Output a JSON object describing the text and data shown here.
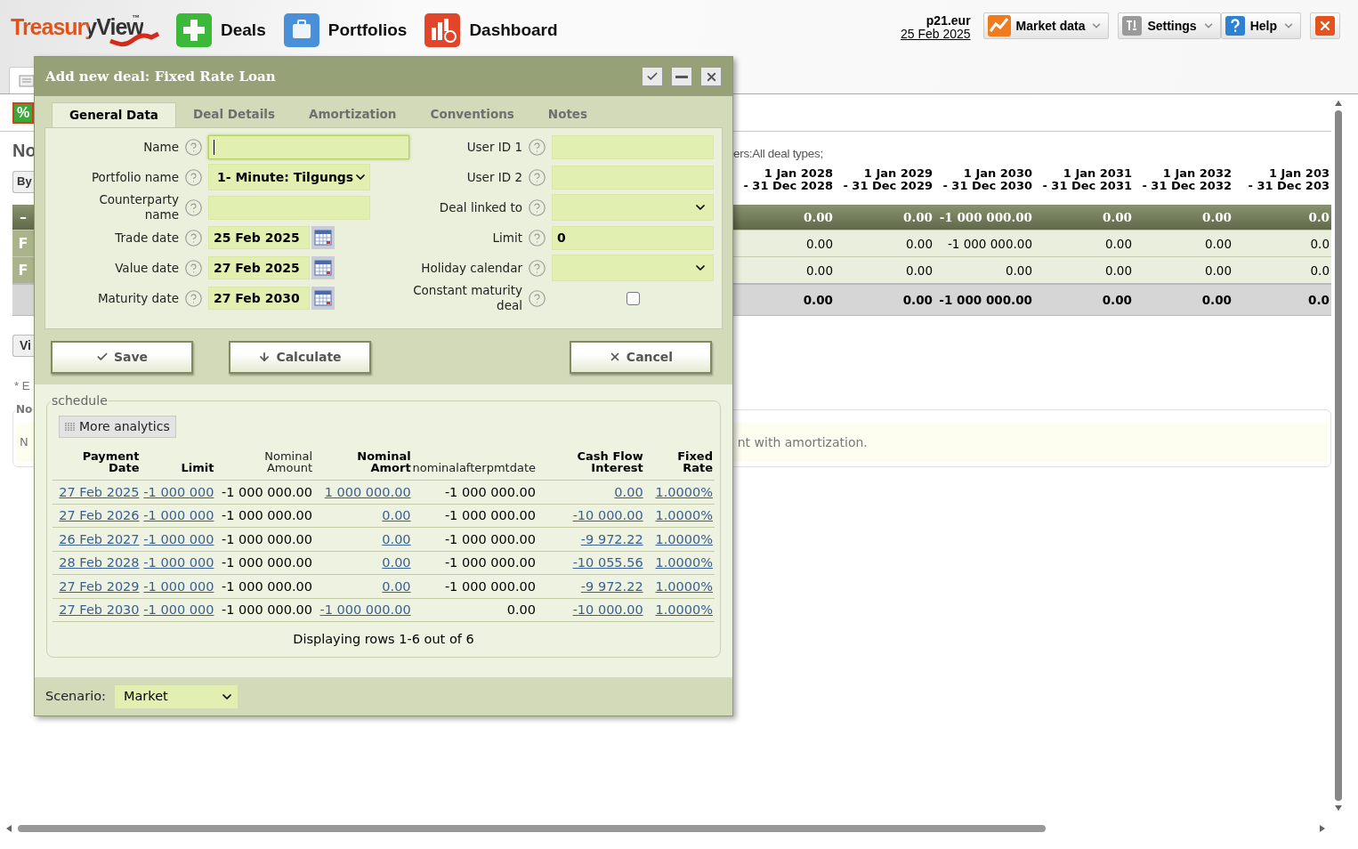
{
  "header": {
    "logo": "TreasuryView",
    "logo_mark": "™",
    "nav": [
      {
        "label": "Deals",
        "kind": "deals"
      },
      {
        "label": "Portfolios",
        "kind": "portfolios"
      },
      {
        "label": "Dashboard",
        "kind": "dashboard"
      }
    ],
    "user": "p21.eur",
    "date": "25 Feb 2025",
    "tools": [
      {
        "label": "Market data",
        "kind": "market"
      },
      {
        "label": "Settings",
        "kind": "settings"
      },
      {
        "label": "Help",
        "kind": "help"
      }
    ]
  },
  "background": {
    "percent_badge": "%",
    "heading": "No",
    "by_button": "By",
    "filter": "ers:All deal types;",
    "columns": [
      {
        "from": "1 Jan 2028",
        "to": "- 31 Dec 2028"
      },
      {
        "from": "1 Jan 2029",
        "to": "- 31 Dec 2029"
      },
      {
        "from": "1 Jan 2030",
        "to": "- 31 Dec 2030"
      },
      {
        "from": "1 Jan 2031",
        "to": "- 31 Dec 2031"
      },
      {
        "from": "1 Jan 2032",
        "to": "- 31 Dec 2032"
      },
      {
        "from": "1 Jan 203",
        "to": "- 31 Dec 203"
      }
    ],
    "group_row": {
      "mark": "–",
      "values": [
        "0.00",
        "0.00",
        "-1 000 000.00",
        "0.00",
        "0.00",
        "0.0"
      ]
    },
    "rows": [
      {
        "mark": "F",
        "values": [
          "0.00",
          "0.00",
          "-1 000 000.00",
          "0.00",
          "0.00",
          "0.0"
        ]
      },
      {
        "mark": "F",
        "values": [
          "0.00",
          "0.00",
          "0.00",
          "0.00",
          "0.00",
          "0.0"
        ]
      }
    ],
    "total_row": [
      "0.00",
      "0.00",
      "-1 000 000.00",
      "0.00",
      "0.00",
      "0.0"
    ],
    "view_button": "Vi",
    "footnote": "* E",
    "note_legend": "No",
    "note_start": "N",
    "note_end": "nt with amortization."
  },
  "dialog": {
    "title": "Add new deal: Fixed Rate Loan",
    "tabs": [
      {
        "label": "General Data",
        "selected": true
      },
      {
        "label": "Deal Details",
        "selected": false
      },
      {
        "label": "Amortization",
        "selected": false
      },
      {
        "label": "Conventions",
        "selected": false
      },
      {
        "label": "Notes",
        "selected": false
      }
    ],
    "left_fields": [
      {
        "label": "Name",
        "kind": "text",
        "focused": true
      },
      {
        "label": "Portfolio name",
        "kind": "select",
        "value": "1- Minute: Tilgungs",
        "focused": false
      },
      {
        "label": "Counterparty name",
        "kind": "text",
        "focused": false
      },
      {
        "label": "Trade date",
        "kind": "date",
        "value": "25 Feb 2025",
        "focused": false
      },
      {
        "label": "Value date",
        "kind": "date",
        "value": "27 Feb 2025",
        "focused": false
      },
      {
        "label": "Maturity date",
        "kind": "date",
        "value": "27 Feb 2030",
        "focused": false
      }
    ],
    "right_fields": [
      {
        "label": "User ID 1",
        "kind": "text",
        "focused": false
      },
      {
        "label": "User ID 2",
        "kind": "text",
        "focused": false
      },
      {
        "label": "Deal linked to",
        "kind": "select",
        "focused": false
      },
      {
        "label": "Limit",
        "kind": "text",
        "value": "0",
        "focused": false
      },
      {
        "label": "Holiday calendar",
        "kind": "select",
        "focused": false
      },
      {
        "label": "Constant maturity deal",
        "kind": "checkbox",
        "checked": false,
        "focused": false
      }
    ],
    "buttons": [
      {
        "label": "Save",
        "kind": "save"
      },
      {
        "label": "Calculate",
        "kind": "calculate"
      },
      {
        "label": "Cancel",
        "kind": "cancel"
      }
    ],
    "schedule": {
      "legend": "schedule",
      "analytics_button": "More analytics",
      "columns": [
        {
          "label": "Payment Date",
          "editable": true
        },
        {
          "label": "Limit",
          "editable": true
        },
        {
          "label": "Nominal Amount",
          "editable": false
        },
        {
          "label": "Nominal Amort",
          "editable": true
        },
        {
          "label": "nominalafterpmtdate",
          "editable": false
        },
        {
          "label": "Cash Flow Interest",
          "editable": true
        },
        {
          "label": "Fixed Rate",
          "editable": true
        }
      ],
      "rows": [
        [
          "27 Feb 2025",
          "-1 000 000",
          "-1 000 000.00",
          "1 000 000.00",
          "-1 000 000.00",
          "0.00",
          "1.0000%"
        ],
        [
          "27 Feb 2026",
          "-1 000 000",
          "-1 000 000.00",
          "0.00",
          "-1 000 000.00",
          "-10 000.00",
          "1.0000%"
        ],
        [
          "26 Feb 2027",
          "-1 000 000",
          "-1 000 000.00",
          "0.00",
          "-1 000 000.00",
          "-9 972.22",
          "1.0000%"
        ],
        [
          "28 Feb 2028",
          "-1 000 000",
          "-1 000 000.00",
          "0.00",
          "-1 000 000.00",
          "-10 055.56",
          "1.0000%"
        ],
        [
          "27 Feb 2029",
          "-1 000 000",
          "-1 000 000.00",
          "0.00",
          "-1 000 000.00",
          "-9 972.22",
          "1.0000%"
        ],
        [
          "27 Feb 2030",
          "-1 000 000",
          "-1 000 000.00",
          "-1 000 000.00",
          "0.00",
          "-10 000.00",
          "1.0000%"
        ]
      ],
      "footer": "Displaying rows 1-6 out of 6"
    },
    "scenario": {
      "label": "Scenario:",
      "value": "Market"
    }
  }
}
